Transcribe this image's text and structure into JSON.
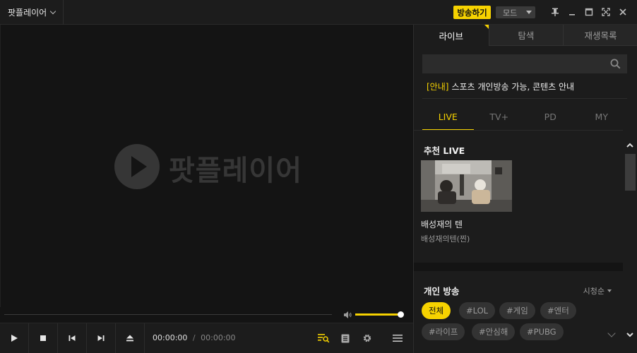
{
  "titlebar": {
    "app_menu_label": "팟플레이어",
    "broadcast_label": "방송하기",
    "mode_label": "모드"
  },
  "video": {
    "logo_text": "팟플레이어"
  },
  "playback": {
    "current_time": "00:00:00",
    "separator": "/",
    "total_time": "00:00:00",
    "volume_level": 0.98
  },
  "panel": {
    "tabs": [
      {
        "label": "라이브",
        "active": true
      },
      {
        "label": "탐색",
        "active": false
      },
      {
        "label": "재생목록",
        "active": false
      }
    ],
    "search": {
      "value": "",
      "placeholder": ""
    },
    "notice": {
      "tag": "[안내]",
      "text": "스포츠 개인방송 가능, 콘텐츠 안내"
    },
    "subtabs": [
      {
        "label": "LIVE",
        "active": true
      },
      {
        "label": "TV+",
        "active": false
      },
      {
        "label": "PD",
        "active": false
      },
      {
        "label": "MY",
        "active": false
      }
    ],
    "recommended": {
      "title": "추천 LIVE",
      "item_title": "배성재의 텐",
      "item_bj": "배성재의텐(찐)"
    },
    "personal": {
      "title": "개인 방송",
      "sort_label": "시청순",
      "chips": [
        {
          "label": "전체",
          "active": true
        },
        {
          "label": "#LOL",
          "active": false
        },
        {
          "label": "#게임",
          "active": false
        },
        {
          "label": "#엔터",
          "active": false
        },
        {
          "label": "#라이프",
          "active": false
        },
        {
          "label": "#안심해",
          "active": false
        },
        {
          "label": "#PUBG",
          "active": false
        }
      ]
    }
  },
  "colors": {
    "accent": "#f6d200",
    "background": "#141414",
    "panel": "#1c1c1c"
  },
  "icons": [
    "chevron-down-icon",
    "pin-icon",
    "minimize-icon",
    "maximize-icon",
    "fullscreen-icon",
    "close-icon",
    "play-icon",
    "stop-icon",
    "previous-icon",
    "next-icon",
    "eject-icon",
    "volume-icon",
    "playlist-search-icon",
    "info-icon",
    "gear-icon",
    "menu-icon",
    "search-icon",
    "scroll-up-icon",
    "scroll-down-icon"
  ]
}
